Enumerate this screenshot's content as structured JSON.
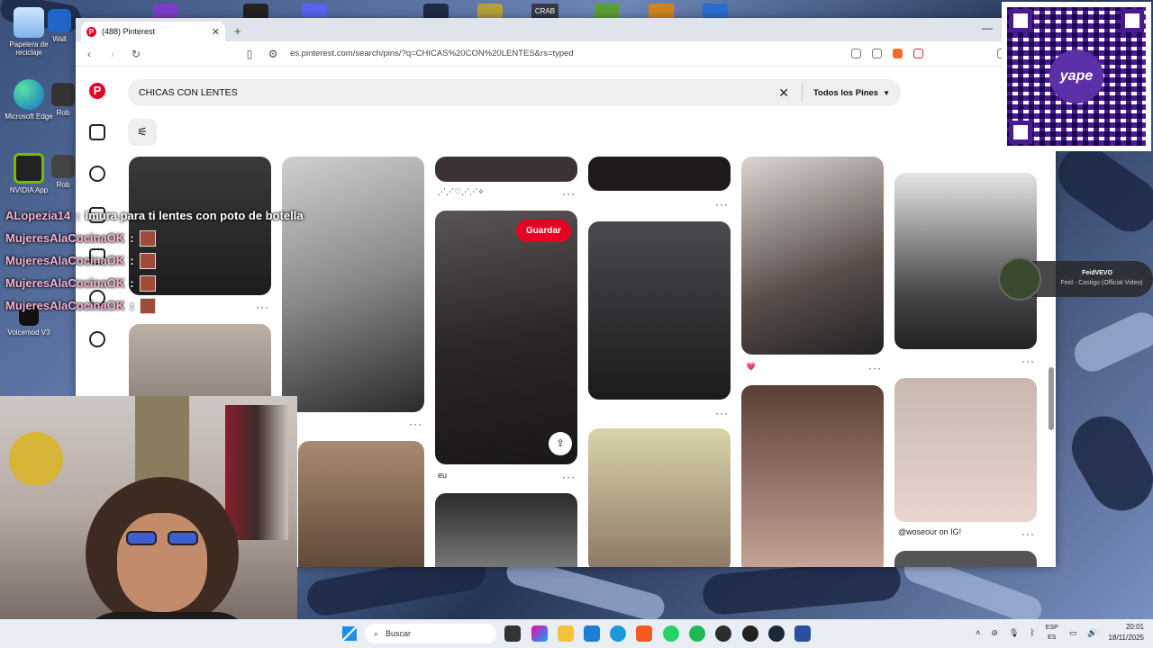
{
  "desktop": {
    "icons": [
      {
        "label": "Papelera de reciclaje"
      },
      {
        "label": "Microsoft Edge"
      },
      {
        "label": "NVIDIA App"
      },
      {
        "label": "Voicemod V3"
      }
    ],
    "partial_icons": [
      "Wall",
      "Rob",
      "Rob",
      "CRAB"
    ]
  },
  "browser": {
    "tab_title": "(488) Pinterest",
    "url": "es.pinterest.com/search/pins/?q=CHICAS%20CON%20LENTES&rs=typed"
  },
  "pinterest": {
    "search_query": "CHICAS CON LENTES",
    "filter_label": "Todos los Pines",
    "save_label": "Guardar",
    "pins": [
      {
        "caption": ""
      },
      {
        "caption": ""
      },
      {
        "caption": "⋰⋰♡⋰⋰✧"
      },
      {
        "caption": "eu"
      },
      {
        "caption": ""
      },
      {
        "caption": "💗"
      },
      {
        "caption": ""
      },
      {
        "caption": "@woseour on IG!"
      }
    ]
  },
  "chat": [
    {
      "user": "ALopezia14",
      "message": "Imura para ti lentes con poto de botella"
    },
    {
      "user": "MujeresAlaCocinaOK",
      "message": ""
    },
    {
      "user": "MujeresAlaCocinaOK",
      "message": ""
    },
    {
      "user": "MujeresAlaCocinaOK",
      "message": ""
    },
    {
      "user": "MujeresAlaCocinaOK",
      "message": ""
    }
  ],
  "music": {
    "artist": "FeidVEVO",
    "track": "Feid - Castigo (Official Video)"
  },
  "qr": {
    "label": "yape"
  },
  "taskbar": {
    "search_placeholder": "Buscar",
    "lang_top": "ESP",
    "lang_bottom": "ES",
    "time": "20:01",
    "date": "18/11/2025"
  }
}
